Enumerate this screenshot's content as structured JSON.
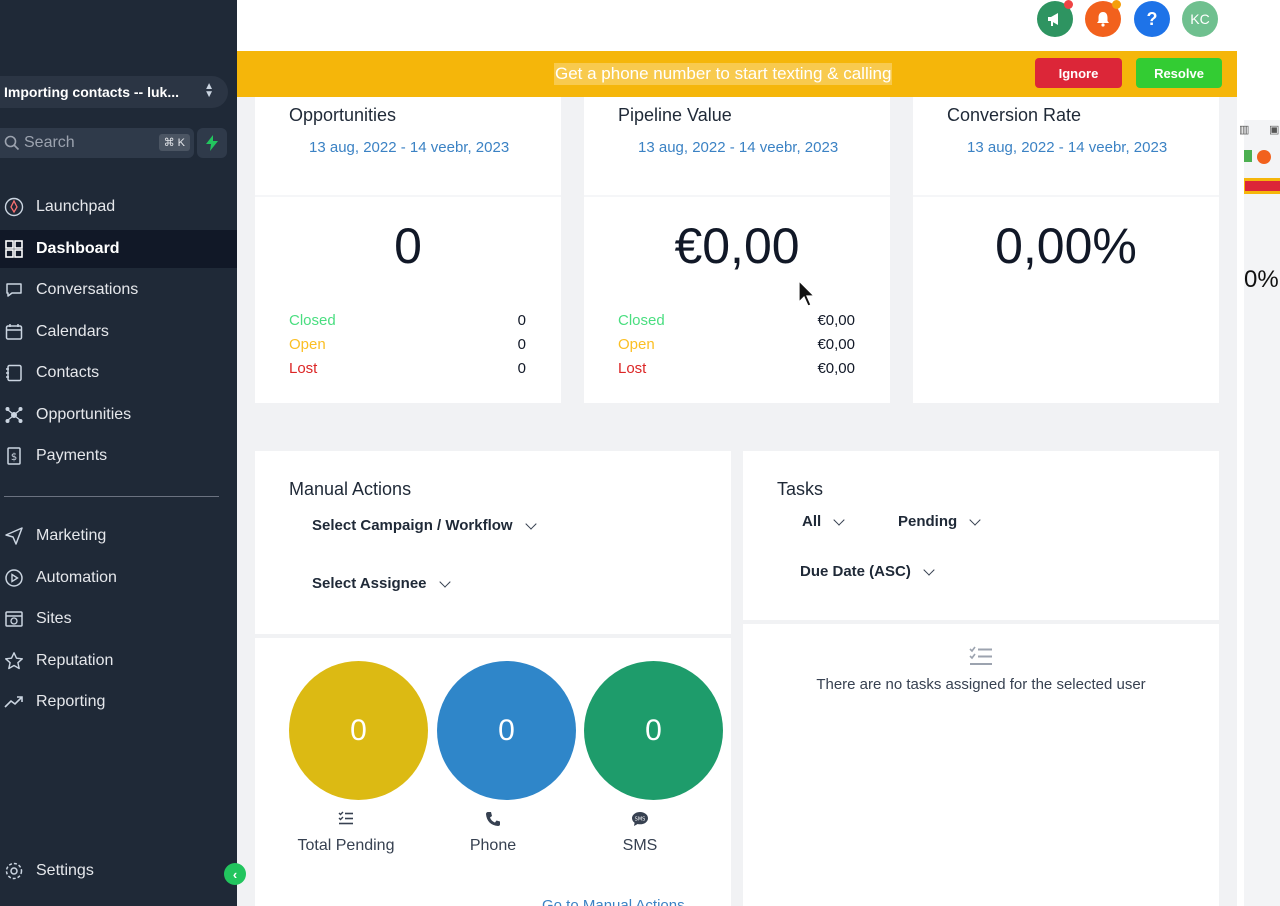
{
  "sidebar": {
    "account": "Importing contacts -- luk...",
    "search_placeholder": "Search",
    "search_shortcut": "⌘ K",
    "items": [
      {
        "label": "Launchpad"
      },
      {
        "label": "Dashboard"
      },
      {
        "label": "Conversations"
      },
      {
        "label": "Calendars"
      },
      {
        "label": "Contacts"
      },
      {
        "label": "Opportunities"
      },
      {
        "label": "Payments"
      },
      {
        "label": "Marketing"
      },
      {
        "label": "Automation"
      },
      {
        "label": "Sites"
      },
      {
        "label": "Reputation"
      },
      {
        "label": "Reporting"
      }
    ],
    "settings": "Settings",
    "active": "Dashboard"
  },
  "topbar": {
    "avatar_initials": "KC",
    "icons": [
      "megaphone-icon",
      "bell-icon",
      "help-icon"
    ]
  },
  "banner": {
    "text": "Get a phone number to start texting & calling",
    "ignore": "Ignore",
    "resolve": "Resolve"
  },
  "stats": {
    "opportunities": {
      "title": "Opportunities",
      "date": "13 aug, 2022 - 14 veebr, 2023",
      "value": "0",
      "closed_label": "Closed",
      "closed": "0",
      "open_label": "Open",
      "open": "0",
      "lost_label": "Lost",
      "lost": "0"
    },
    "pipeline": {
      "title": "Pipeline Value",
      "date": "13 aug, 2022 - 14 veebr, 2023",
      "value": "€0,00",
      "closed_label": "Closed",
      "closed": "€0,00",
      "open_label": "Open",
      "open": "€0,00",
      "lost_label": "Lost",
      "lost": "€0,00"
    },
    "conversion": {
      "title": "Conversion Rate",
      "date": "13 aug, 2022 - 14 veebr, 2023",
      "value": "0,00%"
    }
  },
  "manual_actions": {
    "title": "Manual Actions",
    "campaign_select": "Select Campaign / Workflow",
    "assignee_select": "Select Assignee",
    "bubbles": [
      {
        "value": "0",
        "label": "Total Pending",
        "color": "#dcba13"
      },
      {
        "value": "0",
        "label": "Phone",
        "color": "#2f86c9"
      },
      {
        "value": "0",
        "label": "SMS",
        "color": "#1e9c6b"
      }
    ],
    "link": "Go to Manual Actions"
  },
  "tasks": {
    "title": "Tasks",
    "filter_all": "All",
    "filter_status": "Pending",
    "sort": "Due Date (ASC)",
    "empty": "There are no tasks assigned for the selected user"
  },
  "colors": {
    "sidebar_bg": "#1f2937",
    "banner": "#f5b60a",
    "ignore": "#dc2638",
    "resolve": "#33cc33",
    "link": "#3b82c4"
  }
}
